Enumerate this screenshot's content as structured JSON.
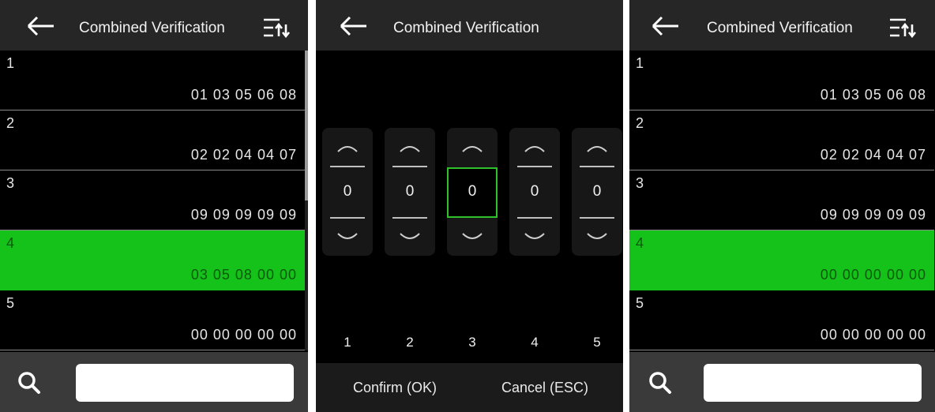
{
  "title": "Combined Verification",
  "icons": {
    "back": "back-arrow-icon",
    "sort": "sort-icon",
    "search": "search-icon",
    "up": "chevron-up-icon",
    "down": "chevron-down-icon"
  },
  "colors": {
    "selected_row": "#15c21a",
    "focus_border": "#2fc12a",
    "titlebar": "#262626",
    "bottombar": "#3a3a3a"
  },
  "list_before": [
    {
      "index": "1",
      "value": "01 03 05 06 08",
      "selected": false
    },
    {
      "index": "2",
      "value": "02 02 04 04 07",
      "selected": false
    },
    {
      "index": "3",
      "value": "09 09 09 09 09",
      "selected": false
    },
    {
      "index": "4",
      "value": "03 05 08 00 00",
      "selected": true
    },
    {
      "index": "5",
      "value": "00 00 00 00 00",
      "selected": false
    }
  ],
  "list_after": [
    {
      "index": "1",
      "value": "01 03 05 06 08",
      "selected": false
    },
    {
      "index": "2",
      "value": "02 02 04 04 07",
      "selected": false
    },
    {
      "index": "3",
      "value": "09 09 09 09 09",
      "selected": false
    },
    {
      "index": "4",
      "value": "00 00 00 00 00",
      "selected": true
    },
    {
      "index": "5",
      "value": "00 00 00 00 00",
      "selected": false
    }
  ],
  "picker": {
    "columns": [
      {
        "label": "1",
        "digit": "0",
        "focused": false
      },
      {
        "label": "2",
        "digit": "0",
        "focused": false
      },
      {
        "label": "3",
        "digit": "0",
        "focused": true
      },
      {
        "label": "4",
        "digit": "0",
        "focused": false
      },
      {
        "label": "5",
        "digit": "0",
        "focused": false
      }
    ],
    "confirm_label": "Confirm (OK)",
    "cancel_label": "Cancel (ESC)"
  },
  "search": {
    "value": "",
    "placeholder": ""
  }
}
